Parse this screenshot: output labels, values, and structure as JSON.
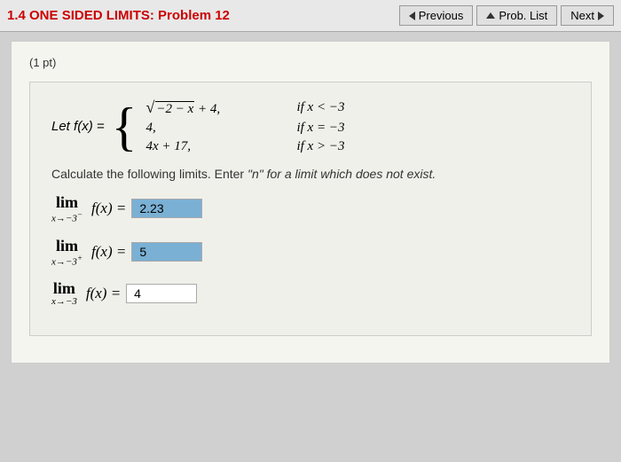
{
  "header": {
    "title": "1.4 ONE SIDED LIMITS: Problem 12",
    "previous_label": "Previous",
    "prob_list_label": "Prob. List",
    "next_label": "Next"
  },
  "problem": {
    "points": "(1 pt)",
    "let_label": "Let f(x) =",
    "cases": [
      {
        "expr": "√(−2 − x) + 4,",
        "condition": "if x < −3"
      },
      {
        "expr": "4,",
        "condition": "if x = −3"
      },
      {
        "expr": "4x + 17,",
        "condition": "if x > −3"
      }
    ],
    "instructions_normal": "Calculate the following limits. Enter ",
    "instructions_quoted": "\"n\"",
    "instructions_italic": " for a limit which does not exist.",
    "limits": [
      {
        "lim_word": "lim",
        "subscript": "x→−3⁻",
        "fx": "f(x) =",
        "answer": "2.23",
        "filled": true
      },
      {
        "lim_word": "lim",
        "subscript": "x→−3⁺",
        "fx": "f(x) =",
        "answer": "5",
        "filled": true
      },
      {
        "lim_word": "lim",
        "subscript": "x→−3",
        "fx": "f(x) =",
        "answer": "4",
        "filled": false
      }
    ]
  }
}
